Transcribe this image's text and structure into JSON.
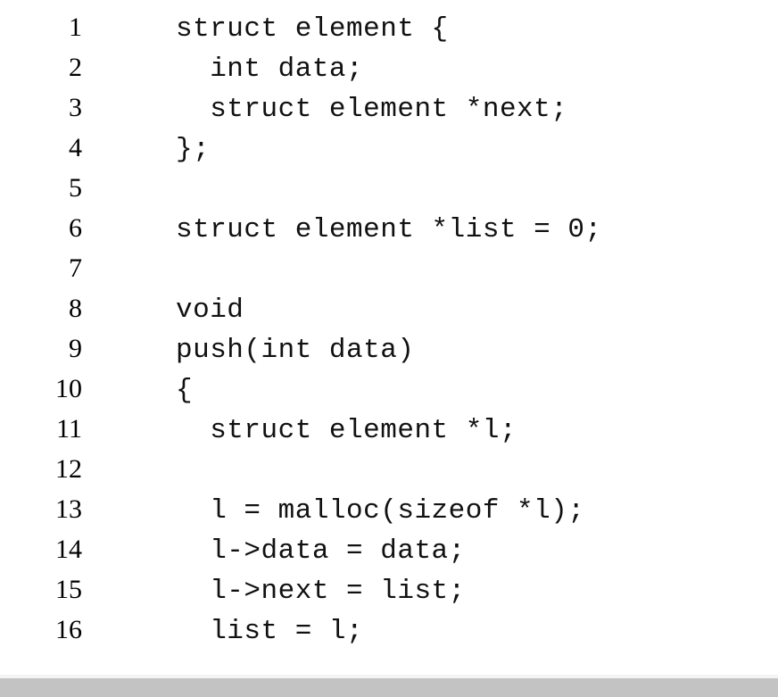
{
  "document": {
    "type": "source-code-listing",
    "language": "c",
    "background_color": "#ffffff",
    "text_color": "#111111",
    "line_number_color": "#000000",
    "footer_bar_color": "#c3c3c3",
    "footer_highlight_color": "#f4f4f4"
  },
  "code": {
    "lines": [
      {
        "number": "1",
        "text": "struct element {"
      },
      {
        "number": "2",
        "text": "  int data;"
      },
      {
        "number": "3",
        "text": "  struct element *next;"
      },
      {
        "number": "4",
        "text": "};"
      },
      {
        "number": "5",
        "text": ""
      },
      {
        "number": "6",
        "text": "struct element *list = 0;"
      },
      {
        "number": "7",
        "text": ""
      },
      {
        "number": "8",
        "text": "void"
      },
      {
        "number": "9",
        "text": "push(int data)"
      },
      {
        "number": "10",
        "text": "{"
      },
      {
        "number": "11",
        "text": "  struct element *l;"
      },
      {
        "number": "12",
        "text": ""
      },
      {
        "number": "13",
        "text": "  l = malloc(sizeof *l);"
      },
      {
        "number": "14",
        "text": "  l->data = data;"
      },
      {
        "number": "15",
        "text": "  l->next = list;"
      },
      {
        "number": "16",
        "text": "  list = l;"
      }
    ]
  }
}
